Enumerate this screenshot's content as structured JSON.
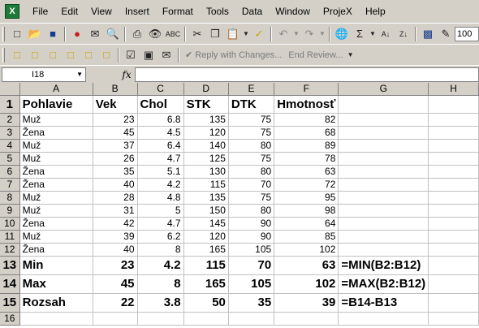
{
  "menubar": {
    "items": [
      "File",
      "Edit",
      "View",
      "Insert",
      "Format",
      "Tools",
      "Data",
      "Window",
      "ProjeX",
      "Help"
    ]
  },
  "toolbar": {
    "zoom": "100",
    "reply_label": "Reply with Changes...",
    "end_review_label": "End Review..."
  },
  "formula_bar": {
    "name_box": "I18",
    "fx_label": "fx",
    "formula": ""
  },
  "sheet": {
    "columns": [
      "A",
      "B",
      "C",
      "D",
      "E",
      "F",
      "G",
      "H"
    ],
    "header_row": [
      "Pohlavie",
      "Vek",
      "Chol",
      "STK",
      "DTK",
      "Hmotnosť"
    ],
    "rows": [
      [
        "Muž",
        "23",
        "6.8",
        "135",
        "75",
        "82"
      ],
      [
        "Žena",
        "45",
        "4.5",
        "120",
        "75",
        "68"
      ],
      [
        "Muž",
        "37",
        "6.4",
        "140",
        "80",
        "89"
      ],
      [
        "Muž",
        "26",
        "4.7",
        "125",
        "75",
        "78"
      ],
      [
        "Žena",
        "35",
        "5.1",
        "130",
        "80",
        "63"
      ],
      [
        "Žena",
        "40",
        "4.2",
        "115",
        "70",
        "72"
      ],
      [
        "Muž",
        "28",
        "4.8",
        "135",
        "75",
        "95"
      ],
      [
        "Muž",
        "31",
        "5",
        "150",
        "80",
        "98"
      ],
      [
        "Žena",
        "42",
        "4.7",
        "145",
        "90",
        "64"
      ],
      [
        "Muž",
        "39",
        "6.2",
        "120",
        "90",
        "85"
      ],
      [
        "Žena",
        "40",
        "8",
        "165",
        "105",
        "102"
      ]
    ],
    "summary": [
      {
        "label": "Min",
        "values": [
          "23",
          "4.2",
          "115",
          "70",
          "63"
        ],
        "formula": "=MIN(B2:B12)"
      },
      {
        "label": "Max",
        "values": [
          "45",
          "8",
          "165",
          "105",
          "102"
        ],
        "formula": "=MAX(B2:B12)"
      },
      {
        "label": "Rozsah",
        "values": [
          "22",
          "3.8",
          "50",
          "35",
          "39"
        ],
        "formula": "=B14-B13"
      }
    ],
    "row_numbers": [
      "1",
      "2",
      "3",
      "4",
      "5",
      "6",
      "7",
      "8",
      "9",
      "10",
      "11",
      "12",
      "13",
      "14",
      "15",
      "16"
    ]
  }
}
